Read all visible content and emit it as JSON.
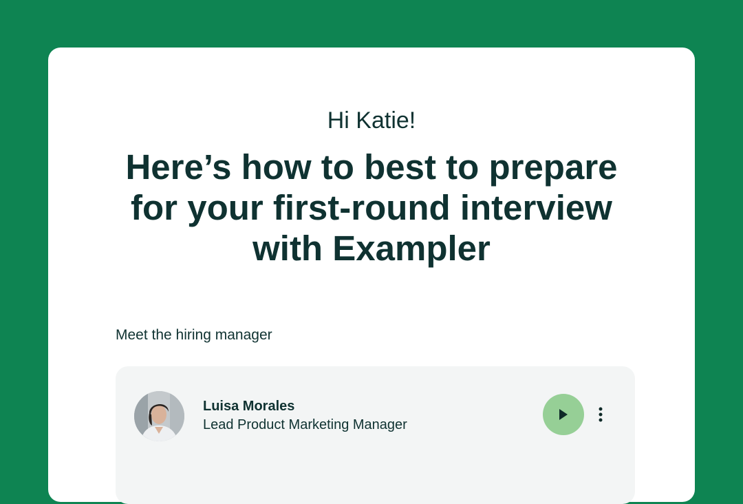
{
  "greeting": "Hi Katie!",
  "headline": {
    "line1": "Here’s how to best to prepare",
    "line2": "for your first-round interview",
    "line3": "with Exampler"
  },
  "section_label": "Meet the hiring manager",
  "manager": {
    "name": "Luisa Morales",
    "title": "Lead Product Marketing Manager"
  },
  "icons": {
    "play": "play-icon",
    "more": "more-vertical-icon"
  },
  "colors": {
    "background": "#0e8452",
    "card": "#ffffff",
    "text": "#0f3231",
    "manager_card": "#f3f5f5",
    "play_button": "#96cf96"
  }
}
